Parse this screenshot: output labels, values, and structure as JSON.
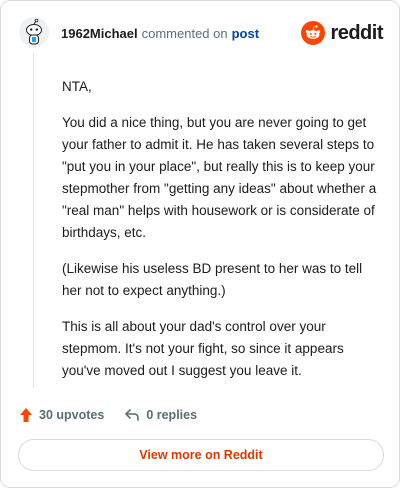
{
  "header": {
    "username": "1962Michael",
    "action_text": "commented on",
    "post_link": "post",
    "brand": "reddit"
  },
  "comment": {
    "paragraphs": [
      "NTA,",
      "You did a nice thing, but you are never going to get your father to admit it. He has taken several steps to \"put you in your place\", but really this is to keep your stepmother from \"getting any ideas\" about whether a \"real man\" helps with housework or is considerate of birthdays, etc.",
      "(Likewise his useless BD present to her was to tell her not to expect anything.)",
      "This is all about your dad's control over your stepmom. It's not your fight, so since it appears you've moved out I suggest you leave it."
    ]
  },
  "footer": {
    "upvotes": "30 upvotes",
    "replies": "0 replies",
    "view_more": "View more on Reddit"
  },
  "colors": {
    "brand": "#ff4500",
    "link": "#0045ac",
    "cta": "#d93a00"
  }
}
